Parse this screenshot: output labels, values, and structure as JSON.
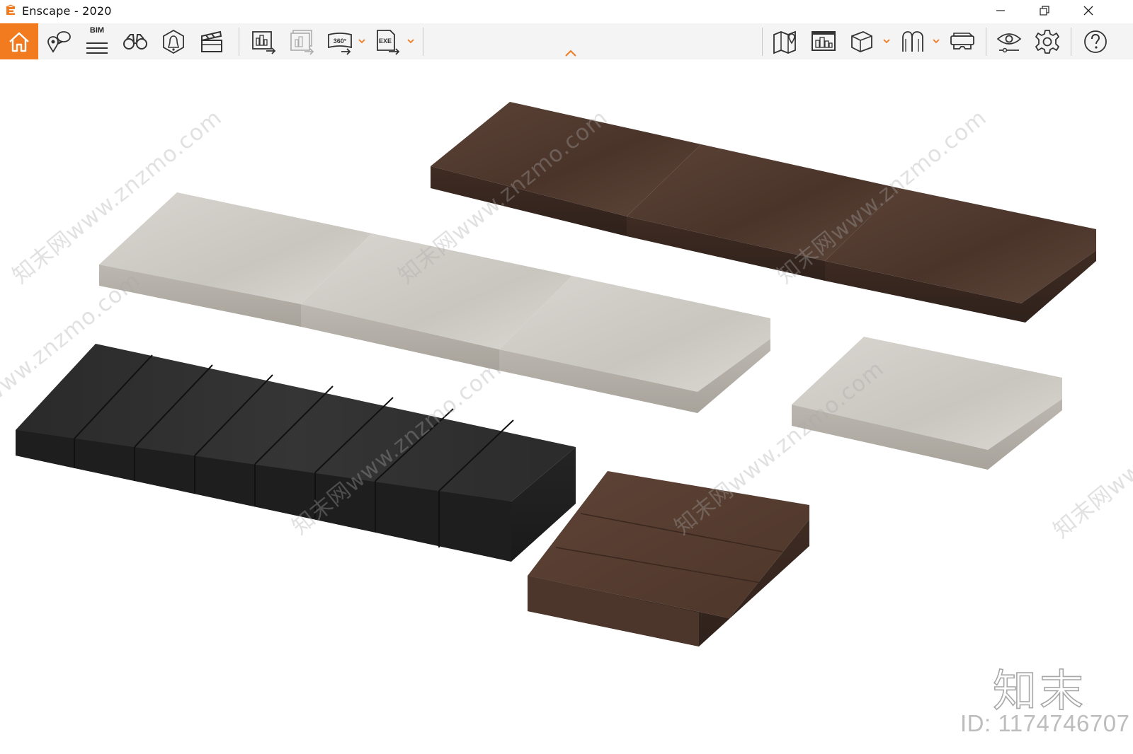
{
  "window": {
    "title": "Enscape - 2020",
    "controls": [
      "minimize",
      "restore",
      "close"
    ]
  },
  "toolbar": {
    "bim_label": "BIM",
    "accent_color": "#f27a1f",
    "left_group": [
      {
        "id": "home",
        "icon": "home-icon"
      },
      {
        "id": "views",
        "icon": "location-views-icon"
      },
      {
        "id": "bim",
        "icon": "bim-info-icon"
      },
      {
        "id": "explore",
        "icon": "binoculars-icon"
      },
      {
        "id": "assets",
        "icon": "asset-library-icon"
      },
      {
        "id": "video",
        "icon": "clapperboard-icon"
      }
    ],
    "export_group": [
      {
        "id": "screenshot-export",
        "icon": "export-image-icon"
      },
      {
        "id": "batch-export",
        "icon": "batch-export-icon",
        "disabled": true
      },
      {
        "id": "panorama-export",
        "icon": "panorama-360-icon",
        "text": "360°",
        "has_dropdown": true
      },
      {
        "id": "exe-export",
        "icon": "exe-export-icon",
        "text": "EXE",
        "has_dropdown": true
      }
    ],
    "right_group": [
      {
        "id": "map",
        "icon": "map-pin-icon"
      },
      {
        "id": "web-standalone",
        "icon": "monitor-city-icon"
      },
      {
        "id": "objects",
        "icon": "cube-icon",
        "has_dropdown": true
      },
      {
        "id": "materials",
        "icon": "material-editor-icon",
        "has_dropdown": true
      },
      {
        "id": "vr",
        "icon": "vr-headset-icon"
      },
      {
        "id": "visual-settings",
        "icon": "eye-settings-icon"
      },
      {
        "id": "general-settings",
        "icon": "gear-icon"
      },
      {
        "id": "help",
        "icon": "help-icon"
      }
    ]
  },
  "viewport": {
    "background": "#ffffff",
    "objects": [
      {
        "name": "brown-leather-seat-cushions",
        "color": "#5a4034"
      },
      {
        "name": "beige-fabric-seat-cushions",
        "color": "#d8d4ce"
      },
      {
        "name": "black-velvet-channel-cushion",
        "color": "#2d2d2d"
      },
      {
        "name": "beige-fabric-single-cushion",
        "color": "#d9d5cf"
      },
      {
        "name": "brown-leather-ottoman-cushion",
        "color": "#5c4134"
      }
    ],
    "watermark_text": "知末网www.znzmo.com",
    "brand_mark": "知末",
    "id_label": "ID: 1174746707"
  }
}
